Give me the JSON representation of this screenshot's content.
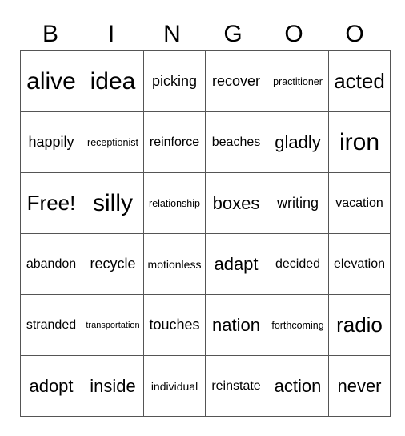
{
  "header": [
    "B",
    "I",
    "N",
    "G",
    "O",
    "O"
  ],
  "rows": [
    [
      "alive",
      "idea",
      "picking",
      "recover",
      "practitioner",
      "acted"
    ],
    [
      "happily",
      "receptionist",
      "reinforce",
      "beaches",
      "gladly",
      "iron"
    ],
    [
      "Free!",
      "silly",
      "relationship",
      "boxes",
      "writing",
      "vacation"
    ],
    [
      "abandon",
      "recycle",
      "motionless",
      "adapt",
      "decided",
      "elevation"
    ],
    [
      "stranded",
      "transportation",
      "touches",
      "nation",
      "forthcoming",
      "radio"
    ],
    [
      "adopt",
      "inside",
      "individual",
      "reinstate",
      "action",
      "never"
    ]
  ]
}
